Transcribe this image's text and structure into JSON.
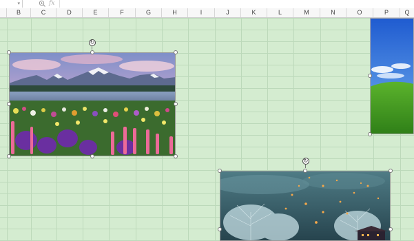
{
  "toolbar": {
    "namebox_dropdown": "▾",
    "zoom_icon": "zoom-icon",
    "fx_label": "fx"
  },
  "columns": [
    "B",
    "C",
    "D",
    "E",
    "F",
    "G",
    "H",
    "I",
    "J",
    "K",
    "L",
    "M",
    "N",
    "O",
    "P",
    "Q"
  ],
  "pictures": [
    {
      "name": "mountain-lake-flowers-picture",
      "selected": true
    },
    {
      "name": "green-hill-sky-picture",
      "selected": false
    },
    {
      "name": "lanterns-frosted-trees-picture",
      "selected": true
    }
  ],
  "colors": {
    "grid_bg": "#d4ecd0",
    "grid_line": "#bcd9ba",
    "header_bg": "#f7f7f7"
  }
}
